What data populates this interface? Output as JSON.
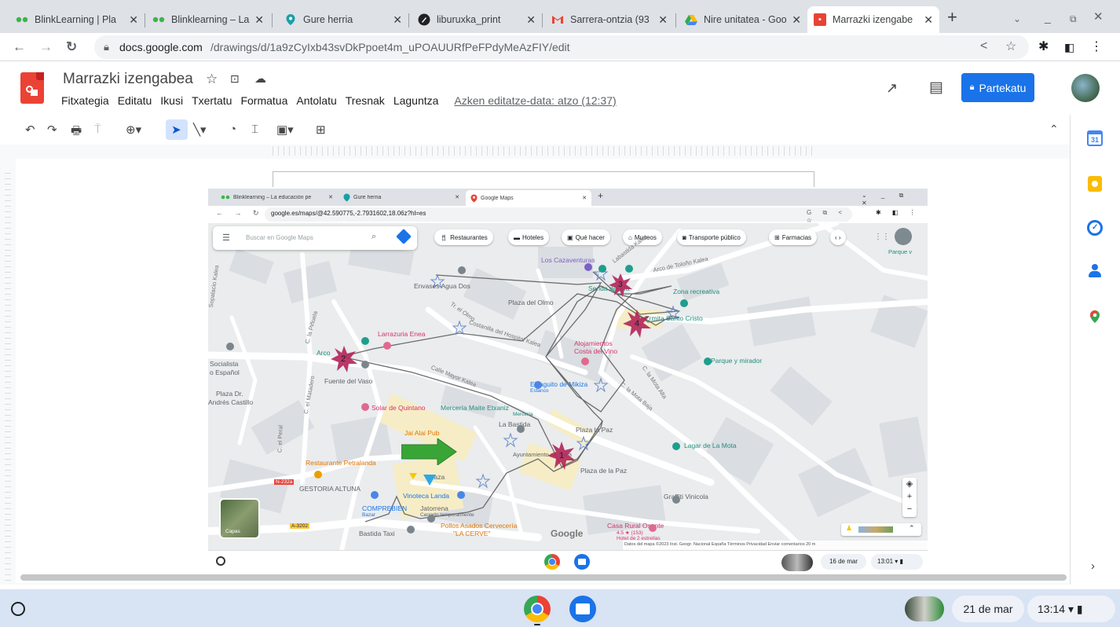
{
  "browser": {
    "tabs": [
      {
        "title": "BlinkLearning | Pla",
        "icon": "blink-dots-icon"
      },
      {
        "title": "Blinklearning – La",
        "icon": "blink-dots-icon"
      },
      {
        "title": "Gure herria",
        "icon": "maps-pin-icon"
      },
      {
        "title": "liburuxka_print",
        "icon": "blackpen-icon"
      },
      {
        "title": "Sarrera-ontzia (93",
        "icon": "gmail-icon"
      },
      {
        "title": "Nire unitatea - Goo",
        "icon": "drive-icon"
      },
      {
        "title": "Marrazki izengabe",
        "icon": "drawings-icon"
      }
    ],
    "url_domain": "docs.google.com",
    "url_path": "/drawings/d/1a9zCyIxb43svDkPpoet4m_uPOAUURfPeFPdyMeAzFIY/edit"
  },
  "doc": {
    "title": "Marrazki izengabea",
    "menu": [
      "Fitxategia",
      "Editatu",
      "Ikusi",
      "Txertatu",
      "Formatua",
      "Antolatu",
      "Tresnak",
      "Laguntza"
    ],
    "last_edit": "Azken editatze-data: atzo (12:37)",
    "share_label": "Partekatu"
  },
  "inner": {
    "tabs": [
      "Blinklearning – La educación pe",
      "Gure herria",
      "Google Maps"
    ],
    "url": "google.es/maps/@42.590775,-2.7931602,18.06z?hl=es",
    "search_placeholder": "Buscar en Google Maps",
    "chips": [
      "Restaurantes",
      "Hoteles",
      "Qué hacer",
      "Museos",
      "Transporte público",
      "Farmacias"
    ],
    "labels": {
      "cazaventuras": "Los Cazaventuras",
      "envases": "Envases Agua Dos",
      "plaza_olmo": "Plaza del Olmo",
      "senda": "Senda del Ma",
      "zona_recreativa": "Zona recreativa",
      "ermita": "Ermita Santo Cristo",
      "larrazuria": "Larrazuria Enea",
      "arco": "Arco",
      "socialista": "Socialista",
      "espanol": "o Español",
      "fuente": "Fuente del Vaso",
      "plaza_dr": "Plaza Dr.",
      "andres": "Andrés Castillo",
      "solar": "Solar de Quintano",
      "merceria": "Mercería Maite Etxaniz",
      "merceria_sub": "Mercería",
      "alojamientos1": "Alojamientos",
      "alojamientos2": "Costa del Vino",
      "parque_mirador": "Parque y mirador",
      "laguito": "El laguito de Mikiza",
      "laguito_sub": "Estanco",
      "la_bastida": "La Bastida",
      "jai_alai": "Jai Alai Pub",
      "plaza_paz1": "Plaza la Paz",
      "plaza_paz2": "Plaza de la Paz",
      "ayuntamiento": "Ayuntamiento de Laba",
      "restaurante": "Restaurante Petralanda",
      "gestoria": "GESTORIA ALTUNA",
      "vinoteca": "Vinoteca Landa",
      "comprebien": "COMPREBIEN",
      "comprebien_sub": "Bazar",
      "jatorrena": "Jatorrena",
      "jatorrena_sub": "Cerrado temporalmente",
      "pollos1": "Pollos Asados Cervecería",
      "pollos2": "\"LA CERVE\"",
      "bastida_taxi": "Bastida Taxi",
      "lagar": "Lagar de La Mota",
      "graffiti": "Graffiti Vinicola",
      "casa_rural": "Casa Rural Osante",
      "casa_rating": "4.5 ★ (153)",
      "casa_sub": "Hotel de 2 estrellas",
      "plaza_label": "Plaza",
      "parque_v": "Parque v",
      "google": "Google",
      "capas": "Capas",
      "footer": "Datos del mapa ©2023 Inst. Geogr. Nacional   España   Términos   Privacidad   Enviar comentarios   20 m",
      "calle_mayor": "Calle Mayor Kalea",
      "costanilla": "Costanilla del Hospital Kalea",
      "olmo_st": "Tr. el Olmo",
      "mota_baja": "C. la Mota Baja",
      "mota_alta": "C. la Mota Alta",
      "arco_toloño": "Arco de Toloño Kalea",
      "lasalde": "Labastida Kalea",
      "matadero": "C. el Matadero",
      "pinuela": "C. la Piñuela",
      "peral": "C. el Peral",
      "sopalacio": "Sopalacio Kalea",
      "n232a": "N-232a",
      "a3202": "A-3202"
    },
    "numbers": [
      "1",
      "2",
      "3",
      "4"
    ],
    "date": "16 de mar",
    "time": "13:01"
  },
  "shelf": {
    "date": "21 de mar",
    "time": "13:14"
  }
}
